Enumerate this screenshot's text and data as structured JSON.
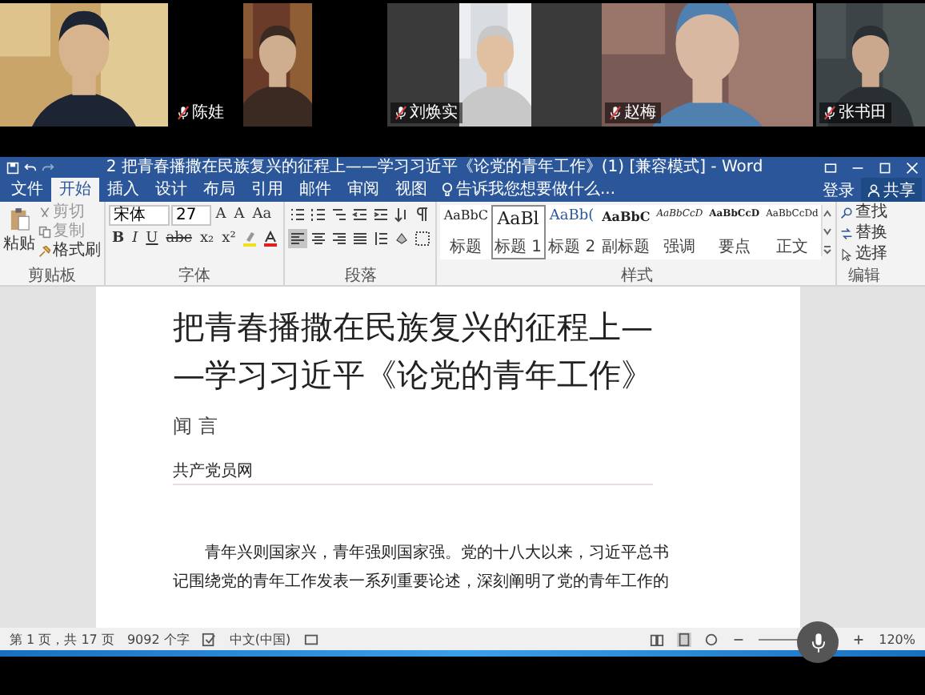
{
  "video_strip": {
    "tiles": [
      {
        "kind": "picture"
      },
      {
        "kind": "picture",
        "name": "陈娃",
        "muted": true
      },
      {
        "kind": "picture",
        "name": "刘焕实",
        "muted": true
      },
      {
        "kind": "picture",
        "name": "赵梅",
        "muted": true
      },
      {
        "kind": "picture",
        "name": "张书田",
        "muted": true
      }
    ]
  },
  "word": {
    "title": "2 把青春播撒在民族复兴的征程上——学习习近平《论党的青年工作》(1) [兼容模式] - Word",
    "tabs": [
      {
        "label": "文件",
        "selected": false
      },
      {
        "label": "开始",
        "selected": true
      },
      {
        "label": "插入",
        "selected": false
      },
      {
        "label": "设计",
        "selected": false
      },
      {
        "label": "布局",
        "selected": false
      },
      {
        "label": "引用",
        "selected": false
      },
      {
        "label": "邮件",
        "selected": false
      },
      {
        "label": "审阅",
        "selected": false
      },
      {
        "label": "视图",
        "selected": false
      }
    ],
    "search": {
      "placeholder": "告诉我您想要做什么..."
    },
    "sign_in": "登录",
    "share": "共享",
    "clipboard": {
      "label": "剪贴板",
      "paste": "粘贴",
      "items": [
        {
          "label": "剪切",
          "disabled": true
        },
        {
          "label": "复制",
          "disabled": true
        },
        {
          "label": "格式刷",
          "disabled": false
        }
      ]
    },
    "font": {
      "label": "字体",
      "family": "宋体",
      "size": "27",
      "row1_buttons": [
        "A",
        "A",
        "Aa"
      ],
      "row2_buttons": [
        "B",
        "I",
        "U",
        "abc",
        "x₂",
        "x²"
      ]
    },
    "paragraph": {
      "label": "段落"
    },
    "styles": {
      "label": "样式",
      "items": [
        {
          "preview": "AaBbC",
          "name": "标题",
          "selected": false
        },
        {
          "preview": "AaBl",
          "name": "标题 1",
          "selected": true
        },
        {
          "preview": "AaBb(",
          "name": "标题 2",
          "selected": false
        },
        {
          "preview": "AaBbC",
          "name": "副标题",
          "selected": false
        },
        {
          "preview": "AaBbCcD",
          "name": "强调",
          "selected": false
        },
        {
          "preview": "AaBbCcD",
          "name": "要点",
          "selected": false
        },
        {
          "preview": "AaBbCcDd",
          "name": "正文",
          "selected": false
        }
      ]
    },
    "editing": {
      "label": "编辑",
      "find": "查找",
      "replace": "替换",
      "select": "选择"
    },
    "document": {
      "title_lines": [
        "把青春播撒在民族复兴的征程上—",
        "—学习习近平《论党的青年工作》"
      ],
      "author": "闻 言",
      "source": "共产党员网",
      "body_lines": [
        "青年兴则国家兴，青年强则国家强。党的十八大以来，习近平总书",
        "记围绕党的青年工作发表一系列重要论述，深刻阐明了党的青年工作的"
      ]
    },
    "status_bar": {
      "page": "第 1 页，共 17 页",
      "words": "9092 个字",
      "language": "中文(中国)",
      "zoom": "120%"
    }
  }
}
